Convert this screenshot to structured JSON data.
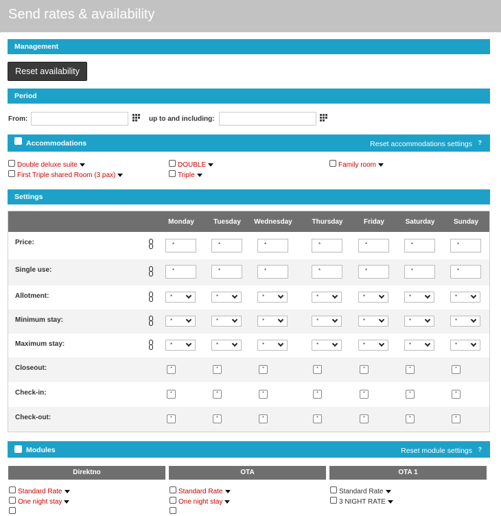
{
  "page": {
    "title": "Send rates & availability"
  },
  "management": {
    "header": "Management",
    "reset_label": "Reset availability"
  },
  "period": {
    "header": "Period",
    "from_label": "From:",
    "to_label": "up to and including:",
    "from_value": "",
    "to_value": ""
  },
  "accommodations": {
    "header": "Accommodations",
    "reset_label": "Reset accommodations settings",
    "help": "?",
    "items": [
      {
        "label": "Double deluxe suite"
      },
      {
        "label": "First Triple shared Room (3 pax)"
      },
      {
        "label": "DOUBLE"
      },
      {
        "label": "Triple"
      },
      {
        "label": "Family room"
      }
    ]
  },
  "settings": {
    "header": "Settings",
    "days": [
      "Monday",
      "Tuesday",
      "Wednesday",
      "Thursday",
      "Friday",
      "Saturday",
      "Sunday"
    ],
    "rows": [
      "Price:",
      "Single use:",
      "Allotment:",
      "Minimum stay:",
      "Maximum stay:",
      "Closeout:",
      "Check-in:",
      "Check-out:"
    ],
    "field_value": "*"
  },
  "modules": {
    "header": "Modules",
    "reset_label": "Reset module settings",
    "help": "?",
    "columns": [
      {
        "name": "Direktno",
        "items": [
          "Standard Rate",
          "One night stay"
        ]
      },
      {
        "name": "OTA",
        "items": [
          "Standard Rate",
          "One night stay"
        ]
      },
      {
        "name": "OTA 1",
        "items": [
          "Standard Rate",
          "3 NIGHT RATE"
        ]
      }
    ]
  },
  "colors": {
    "accent": "#1ea1c8",
    "title_bar": "#c2c2c2",
    "table_header": "#6f6f6f",
    "link_red": "#cc0000"
  }
}
